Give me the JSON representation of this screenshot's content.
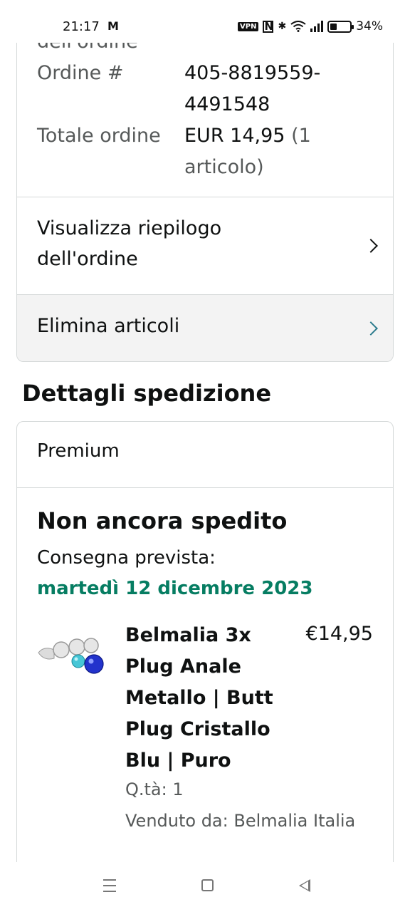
{
  "status_bar": {
    "time": "21:17",
    "mail_icon": "gmail-icon",
    "vpn": "VPN",
    "nfc": "N",
    "battery": "34%",
    "battery_level": 0.34
  },
  "order_summary": {
    "cut_label": "dell'ordine",
    "order_number_label": "Ordine #",
    "order_number_value": "405-8819559-4491548",
    "total_label": "Totale ordine",
    "total_value": "EUR 14,95",
    "total_items": "(1 articolo)",
    "view_summary": "Visualizza riepilogo dell'ordine",
    "delete_items": "Elimina articoli"
  },
  "shipping": {
    "section_title": "Dettagli spedizione",
    "service": "Premium",
    "status": "Non ancora spedito",
    "delivery_label": "Consegna prevista:",
    "delivery_date": "martedì 12 dicembre 2023",
    "item": {
      "title": "Belmalia 3x Plug Anale Metallo | Butt Plug Cristallo Blu | Puro",
      "price": "€14,95",
      "quantity": "Q.tà: 1",
      "seller": "Venduto da: Belmalia Italia"
    }
  },
  "colors": {
    "delivery_green": "#067d62",
    "chevron_teal": "#2a7a8c",
    "muted_text": "#565959"
  }
}
